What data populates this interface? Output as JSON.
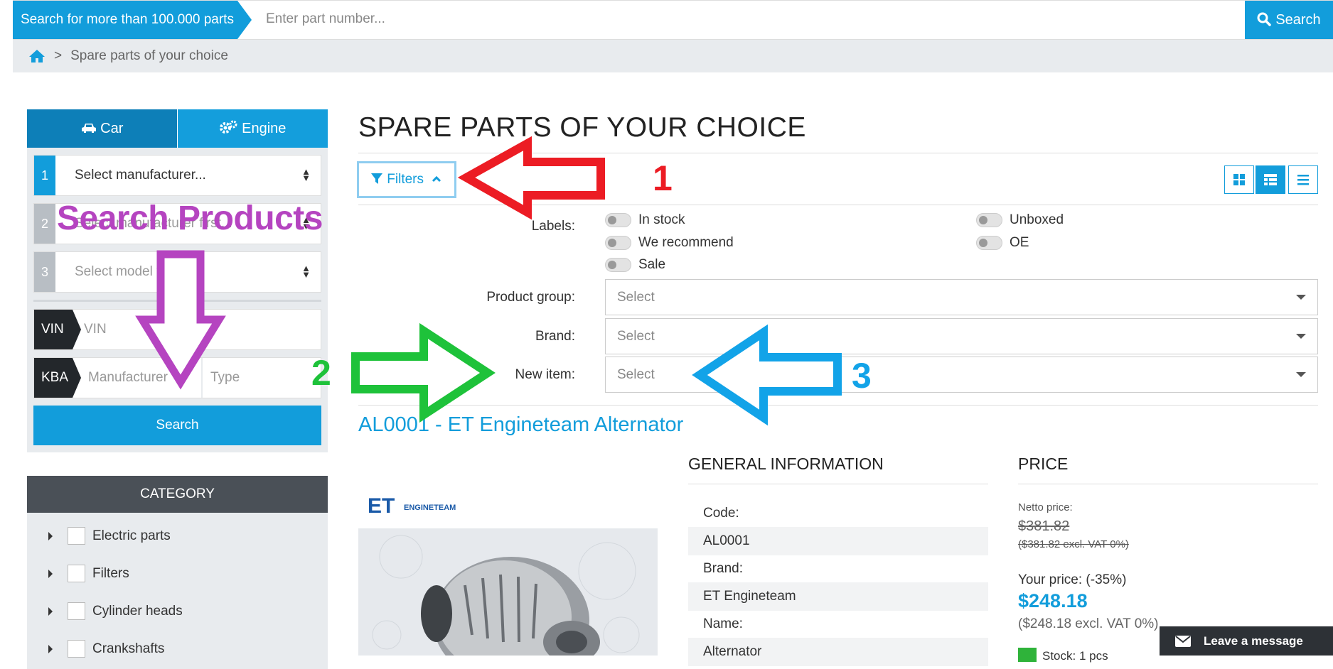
{
  "topbar": {
    "label": "Search for more than 100.000 parts",
    "placeholder": "Enter part number...",
    "search": "Search"
  },
  "breadcrumb": {
    "separator": ">",
    "current": "Spare parts of your choice"
  },
  "sidebar": {
    "tabs": [
      {
        "label": "Car",
        "icon": "car-icon"
      },
      {
        "label": "Engine",
        "icon": "gears-icon"
      }
    ],
    "selects": [
      {
        "num": "1",
        "text": "Select manufacturer..."
      },
      {
        "num": "2",
        "text": "Select manufacturer first..."
      },
      {
        "num": "3",
        "text": "Select model first..."
      }
    ],
    "vin": {
      "tag": "VIN",
      "placeholder": "VIN"
    },
    "kba": {
      "tag": "KBA",
      "manufacturer": "Manufacturer",
      "type": "Type"
    },
    "search": "Search",
    "category": {
      "title": "CATEGORY",
      "items": [
        "Electric parts",
        "Filters",
        "Cylinder heads",
        "Crankshafts"
      ]
    }
  },
  "main": {
    "title": "SPARE PARTS OF YOUR CHOICE",
    "filters_label": "Filters",
    "labels_label": "Labels:",
    "toggles": [
      "In stock",
      "We recommend",
      "Sale",
      "Unboxed",
      "OE"
    ],
    "product_group": {
      "label": "Product group:",
      "value": "Select"
    },
    "brand": {
      "label": "Brand:",
      "value": "Select"
    },
    "new_item": {
      "label": "New item:",
      "value": "Select"
    },
    "product": {
      "title": "AL0001 - ET Engineteam Alternator",
      "logo": "ENGINETEAM",
      "general_heading": "GENERAL INFORMATION",
      "info": [
        "Code:",
        "AL0001",
        "Brand:",
        "ET Engineteam",
        "Name:",
        "Alternator"
      ],
      "price_heading": "PRICE",
      "netto_label": "Netto price:",
      "netto_value": "$381.82",
      "netto_excl": "($381.82 excl. VAT 0%)",
      "your_price_label": "Your price: (-35%)",
      "your_price": "$248.18",
      "your_excl": "($248.18 excl. VAT 0%)",
      "stock": "Stock: 1 pcs"
    }
  },
  "chat": {
    "label": "Leave a message"
  },
  "annotations": {
    "search_products": "Search Products",
    "n1": "1",
    "n2": "2",
    "n3": "3",
    "colors": {
      "red": "#ec1c24",
      "purple": "#b544c0",
      "green": "#1ec23a",
      "blue": "#12a3e8"
    }
  }
}
